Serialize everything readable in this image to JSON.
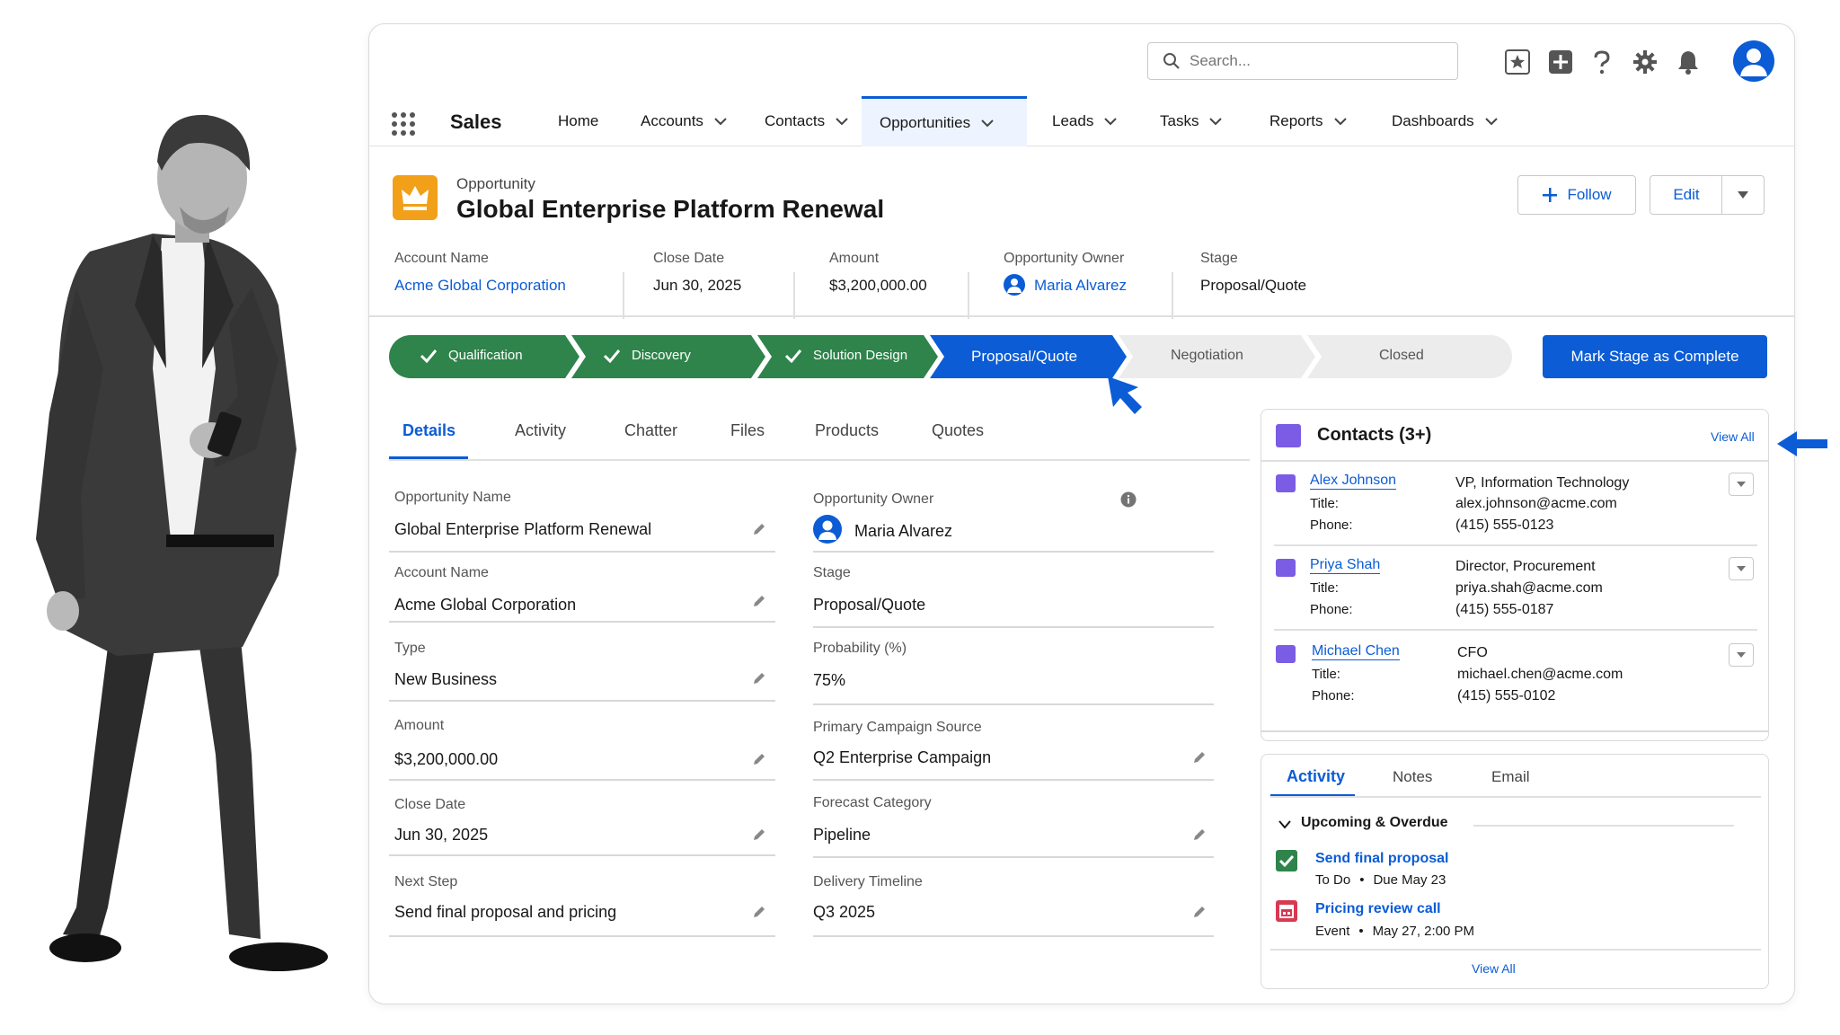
{
  "topbar": {
    "search_placeholder": "Search...",
    "icons": [
      "star-icon",
      "plus-box-icon",
      "help-icon",
      "gear-icon",
      "bell-icon",
      "user-avatar"
    ]
  },
  "nav": {
    "app_name": "Sales",
    "items": [
      {
        "label": "Home",
        "has_menu": false
      },
      {
        "label": "Accounts",
        "has_menu": true
      },
      {
        "label": "Contacts",
        "has_menu": true
      },
      {
        "label": "Opportunities",
        "has_menu": true,
        "active": true
      },
      {
        "label": "Leads",
        "has_menu": true
      },
      {
        "label": "Tasks",
        "has_menu": true
      },
      {
        "label": "Reports",
        "has_menu": true
      },
      {
        "label": "Dashboards",
        "has_menu": true
      }
    ]
  },
  "record": {
    "type": "Opportunity",
    "title": "Global Enterprise Platform Renewal",
    "follow_label": "Follow",
    "edit_label": "Edit",
    "highlights": [
      {
        "label": "Account Name",
        "value": "Acme Global Corporation",
        "link": true
      },
      {
        "label": "Close Date",
        "value": "Jun 30, 2025"
      },
      {
        "label": "Amount",
        "value": "$3,200,000.00"
      },
      {
        "label": "Opportunity Owner",
        "value": "Maria Alvarez",
        "link": true
      },
      {
        "label": "Stage",
        "value": "Proposal/Quote"
      }
    ]
  },
  "path": {
    "steps": [
      {
        "label": "Qualification",
        "state": "complete"
      },
      {
        "label": "Discovery",
        "state": "complete"
      },
      {
        "label": "Solution Design",
        "state": "complete"
      },
      {
        "label": "Proposal/Quote",
        "state": "current"
      },
      {
        "label": "Negotiation",
        "state": "incomplete"
      },
      {
        "label": "Closed",
        "state": "incomplete"
      }
    ],
    "mark_button": "Mark Stage as Complete"
  },
  "tabs": [
    "Details",
    "Activity",
    "Chatter",
    "Files",
    "Products",
    "Quotes"
  ],
  "details": {
    "left": [
      {
        "label": "Opportunity Name",
        "value": "Global Enterprise Platform Renewal"
      },
      {
        "label": "Account Name",
        "value": "Acme Global Corporation",
        "link": true
      },
      {
        "label": "Type",
        "value": "New Business"
      },
      {
        "label": "Amount",
        "value": "$3,200,000.00"
      },
      {
        "label": "Close Date",
        "value": "Jun 30, 2025"
      },
      {
        "label": "Next Step",
        "value": "Send final proposal and pricing"
      }
    ],
    "right": [
      {
        "label": "Opportunity Owner",
        "value": "Maria Alvarez",
        "link": true
      },
      {
        "label": "Stage",
        "value": "Proposal/Quote"
      },
      {
        "label": "Probability (%)",
        "value": "75%"
      },
      {
        "label": "Primary Campaign Source",
        "value": "Q2 Enterprise Campaign",
        "link": true
      },
      {
        "label": "Forecast Category",
        "value": "Pipeline"
      },
      {
        "label": "Delivery Timeline",
        "value": "Q3 2025"
      }
    ]
  },
  "contacts": {
    "title": "Contacts (3+)",
    "view_all": "View All",
    "title_label": "Title:",
    "phone_label": "Phone:",
    "items": [
      {
        "name": "Alex Johnson",
        "title": "VP, Information Technology",
        "email": "alex.johnson@acme.com",
        "phone": "(415) 555-0123"
      },
      {
        "name": "Priya Shah",
        "title": "Director, Procurement",
        "email": "priya.shah@acme.com",
        "phone": "(415) 555-0187"
      },
      {
        "name": "Michael Chen",
        "title": "CFO",
        "email": "michael.chen@acme.com",
        "phone": "(415) 555-0102"
      }
    ]
  },
  "activity": {
    "tabs": [
      "Activity",
      "Notes",
      "Email"
    ],
    "section": "Upcoming & Overdue",
    "items": [
      {
        "title": "Send final proposal",
        "kind": "To Do",
        "sep": "•",
        "when": "Due May 23"
      },
      {
        "title": "Pricing review call",
        "kind": "Event",
        "sep": "•",
        "when": "May 27, 2:00 PM"
      }
    ],
    "view_all": "View All"
  },
  "colors": {
    "brand": "#0b5cd5",
    "complete": "#2e844a",
    "incomplete": "#ececec",
    "opportunity_icon": "#f2a019",
    "contact_icon": "#7b5ce5",
    "event_icon": "#d83a52"
  }
}
